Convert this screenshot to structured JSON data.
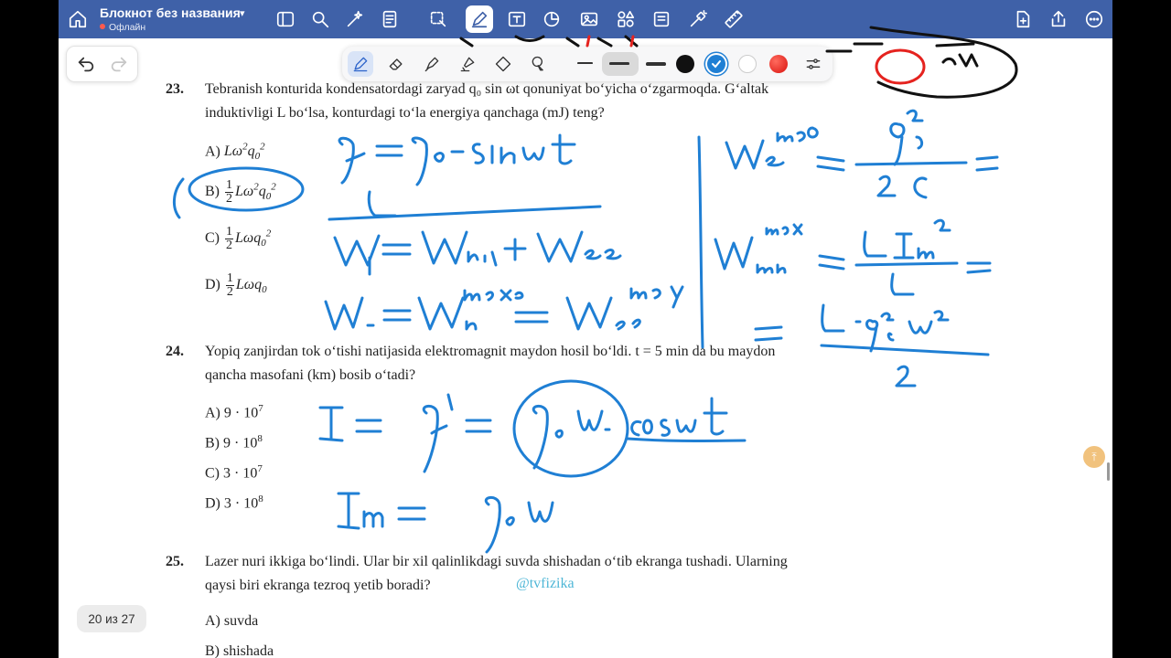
{
  "topbar": {
    "doc_title": "Блокнот без названия",
    "doc_status": "Офлайн"
  },
  "page_indicator": "20 из 27",
  "watermark": "@tvfizika",
  "colors": {
    "toolbar_bg": "#3f61a8",
    "ink_blue": "#1f7fd4",
    "swatch_black": "#111111",
    "swatch_blue": "#1f7fd4",
    "swatch_white": "#ffffff",
    "swatch_red": "#e5231f"
  },
  "questions": {
    "q23": {
      "number": "23.",
      "line1": "Tebranish konturida kondensatordagi zaryad q₀ sin ωt qonuniyat bo‘yicha o‘zgarmoqda. G‘altak",
      "line2": "induktivligi L bo‘lsa, konturdagi to‘la energiya qanchaga (mJ) teng?",
      "options": [
        "A)",
        "B)",
        "C)",
        "D)"
      ]
    },
    "q24": {
      "number": "24.",
      "line1": "Yopiq zanjirdan tok o‘tishi natijasida elektromagnit maydon hosil bo‘ldi. t = 5 min da bu maydon",
      "line2": "qancha masofani (km) bosib o‘tadi?",
      "options": [
        "A) 9 · 10",
        "B) 9 · 10",
        "C) 3 · 10",
        "D) 3 · 10"
      ],
      "exponents": [
        "7",
        "8",
        "7",
        "8"
      ]
    },
    "q25": {
      "number": "25.",
      "line1": "Lazer nuri ikkiga bo‘lindi. Ular bir xil qalinlikdagi suvda shishadan o‘tib ekranga tushadi. Ularning",
      "line2": "qaysi biri ekranga tezroq yetib boradi?",
      "options": [
        "A) suvda",
        "B) shishada"
      ]
    }
  }
}
